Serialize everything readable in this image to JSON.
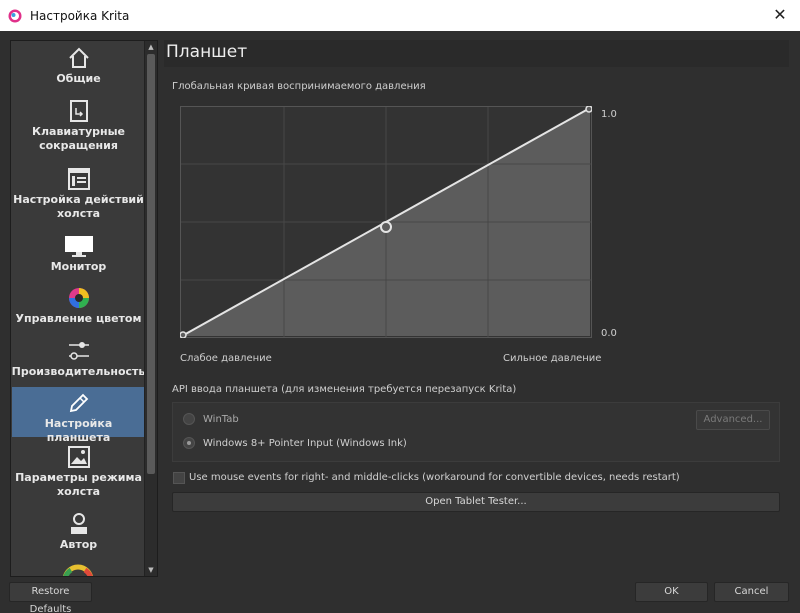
{
  "window": {
    "title": "Настройка Krita",
    "close_glyph": "✕"
  },
  "sidebar": {
    "items": [
      {
        "label": "Общие",
        "icon": "home-icon"
      },
      {
        "label": "Клавиатурные сокращения",
        "icon": "shortcut-icon"
      },
      {
        "label": "Настройка действий холста",
        "icon": "canvas-input-icon"
      },
      {
        "label": "Монитор",
        "icon": "monitor-icon"
      },
      {
        "label": "Управление цветом",
        "icon": "color-wheel-icon"
      },
      {
        "label": "Производительность",
        "icon": "sliders-icon"
      },
      {
        "label": "Настройка планшета",
        "icon": "pen-icon",
        "active": true
      },
      {
        "label": "Параметры режима холста",
        "icon": "image-icon"
      },
      {
        "label": "Автор",
        "icon": "person-icon"
      }
    ]
  },
  "page": {
    "title": "Планшет",
    "curve_label": "Глобальная кривая воспринимаемого давления",
    "curve_max": "1.0",
    "curve_min": "0.0",
    "weak_pressure": "Слабое давление",
    "strong_pressure": "Сильное давление",
    "api_label": "API ввода планшета (для изменения требуется перезапуск Krita)",
    "wintab_label": "WinTab",
    "windows_ink_label": "Windows 8+ Pointer Input (Windows Ink)",
    "advanced_button": "Advanced...",
    "mouse_events_label": "Use mouse events for right- and middle-clicks (workaround for convertible devices, needs restart)",
    "tablet_tester_button": "Open Tablet Tester..."
  },
  "footer": {
    "restore_defaults": "Restore Defaults",
    "ok": "OK",
    "cancel": "Cancel"
  },
  "colors": {
    "accent_active": "#4a6d95",
    "background": "#2f2f2f"
  }
}
